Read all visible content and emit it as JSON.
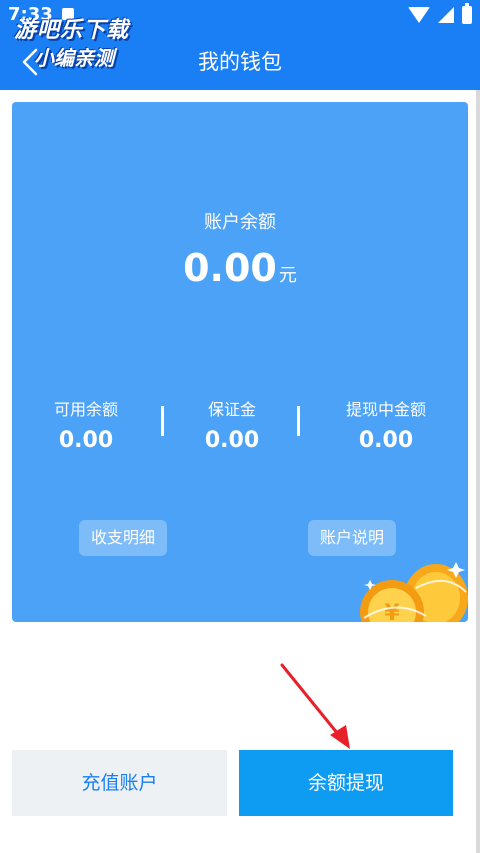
{
  "status_bar": {
    "time": "7:33"
  },
  "watermark": {
    "line1": "游吧乐下载",
    "line2": "小编亲测"
  },
  "header": {
    "title": "我的钱包",
    "back_icon": "chevron-left-icon"
  },
  "card": {
    "balance_label": "账户余额",
    "balance_value": "0.00",
    "balance_unit": "元",
    "stats": [
      {
        "label": "可用余额",
        "value": "0.00"
      },
      {
        "label": "保证金",
        "value": "0.00"
      },
      {
        "label": "提现中金额",
        "value": "0.00"
      }
    ],
    "detail_button": "收支明细",
    "explain_button": "账户说明"
  },
  "actions": {
    "recharge": "充值账户",
    "withdraw": "余额提现"
  },
  "colors": {
    "header": "#1a7ff5",
    "card": "#4ba2f7",
    "withdraw": "#0e9bf2",
    "arrow": "#e8202a"
  }
}
